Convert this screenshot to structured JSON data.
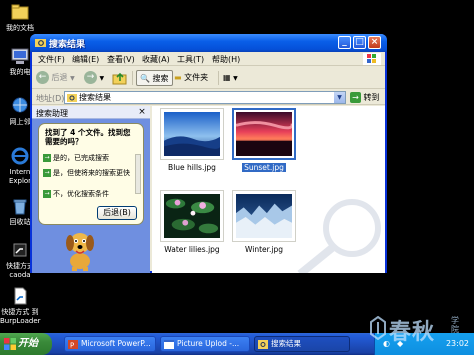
{
  "desktop": {
    "icons": [
      {
        "label": "我的文档"
      },
      {
        "label": "我的电"
      },
      {
        "label": "网上邻"
      },
      {
        "label": "Intern"
      },
      {
        "label": "Explor"
      },
      {
        "label": "回收站"
      },
      {
        "label": "快捷方式"
      },
      {
        "label": "caoda"
      },
      {
        "label": "快捷方式 到"
      },
      {
        "label": "BurpLoader"
      }
    ]
  },
  "window": {
    "title": "搜索结果",
    "menu": [
      "文件(F)",
      "编辑(E)",
      "查看(V)",
      "收藏(A)",
      "工具(T)",
      "帮助(H)"
    ],
    "toolbar": {
      "back": "后退",
      "search": "搜索",
      "folders": "文件夹"
    },
    "address": {
      "label": "地址(D)",
      "value": "搜索结果",
      "go": "转到"
    }
  },
  "search_pane": {
    "title": "搜索助理",
    "question": "找到了 4 个文件。找到您需要的吗？",
    "options": [
      "是的，已完成搜索",
      "是，但使将来的搜索更快",
      "不，优化搜索条件"
    ],
    "back_button": "后退(B)"
  },
  "files": [
    {
      "name": "Blue hills.jpg",
      "selected": false
    },
    {
      "name": "Sunset.jpg",
      "selected": true
    },
    {
      "name": "Water lilies.jpg",
      "selected": false
    },
    {
      "name": "Winter.jpg",
      "selected": false
    }
  ],
  "taskbar": {
    "start": "开始",
    "tasks": [
      {
        "label": "Microsoft PowerP..."
      },
      {
        "label": "Picture Uplod -..."
      },
      {
        "label": "搜索结果"
      }
    ],
    "clock": "23:02"
  },
  "brand": {
    "text": "春秋",
    "sub": "学院"
  }
}
